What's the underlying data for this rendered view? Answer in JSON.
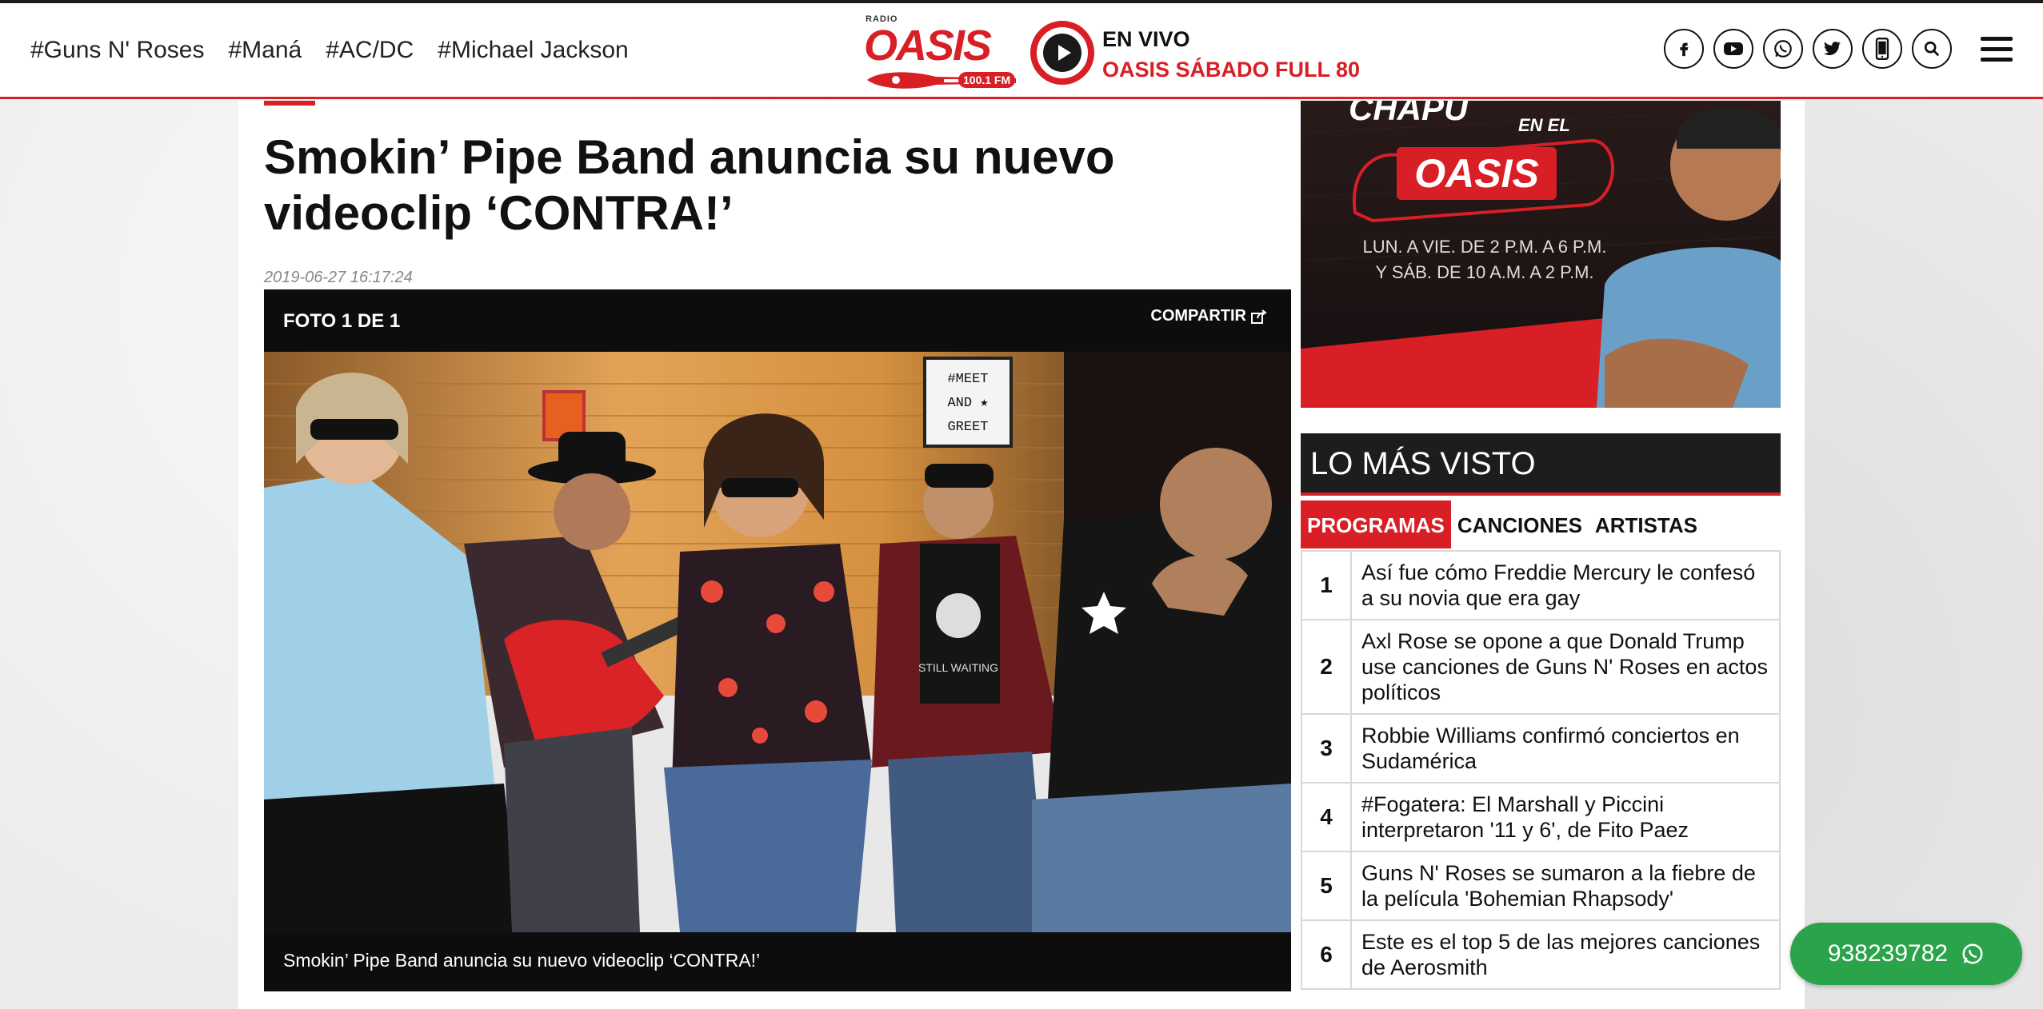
{
  "header": {
    "tags": [
      "#Guns N' Roses",
      "#Maná",
      "#AC/DC",
      "#Michael Jackson"
    ],
    "logo": {
      "radio": "RADIO",
      "name": "OASIS",
      "freq": "100.1 FM"
    },
    "live_label": "EN VIVO",
    "live_show": "OASIS SÁBADO FULL 80",
    "social_icons": [
      "facebook-icon",
      "youtube-icon",
      "whatsapp-icon",
      "twitter-icon",
      "mobile-icon",
      "search-icon"
    ]
  },
  "article": {
    "title": "Smokin’ Pipe Band anuncia su nuevo videoclip ‘CONTRA!’",
    "date": "2019-06-27 16:17:24",
    "gallery": {
      "counter": "FOTO 1 DE 1",
      "share": "COMPARTIR",
      "caption": "Smokin’ Pipe Band anuncia su nuevo videoclip ‘CONTRA!’",
      "sign": [
        "#MEET",
        "AND ★",
        "GREET"
      ]
    }
  },
  "ad": {
    "line1": "CHAPU",
    "line2": "EN EL",
    "brand": "OASIS",
    "schedule1": "LUN. A VIE. DE 2 P.M. A 6 P.M.",
    "schedule2": "Y SÁB. DE 10 A.M. A 2 P.M."
  },
  "most_viewed": {
    "title": "LO MÁS VISTO",
    "tabs": [
      "PROGRAMAS",
      "CANCIONES",
      "ARTISTAS"
    ],
    "active_tab": "PROGRAMAS",
    "items": [
      {
        "num": "1",
        "text": "Así fue cómo Freddie Mercury le confesó a su novia que era gay"
      },
      {
        "num": "2",
        "text": "Axl Rose se opone a que Donald Trump use canciones de Guns N' Roses en actos políticos"
      },
      {
        "num": "3",
        "text": "Robbie Williams confirmó conciertos en Sudamérica"
      },
      {
        "num": "4",
        "text": "#Fogatera: El Marshall y Piccini interpretaron '11 y 6', de Fito Paez"
      },
      {
        "num": "5",
        "text": "Guns N' Roses se sumaron a la fiebre de la película 'Bohemian Rhapsody'"
      },
      {
        "num": "6",
        "text": "Este es el top 5 de las mejores canciones de Aerosmith"
      }
    ]
  },
  "whatsapp": {
    "number": "938239782"
  },
  "colors": {
    "brand_red": "#d81f26",
    "whatsapp_green": "#2aa34a",
    "dark": "#1d1d1d"
  }
}
